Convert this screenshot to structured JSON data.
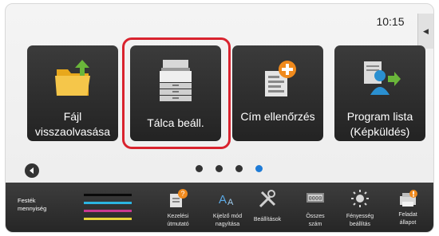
{
  "status": {
    "time": "10:15"
  },
  "tiles": [
    {
      "label": "Fájl visszaolvasása",
      "icon": "folder-upload-icon"
    },
    {
      "label": "Tálca beáll.",
      "icon": "printer-tray-icon"
    },
    {
      "label": "Cím ellenőrzés",
      "icon": "address-book-add-icon"
    },
    {
      "label": "Program lista (Képküldés)",
      "icon": "program-list-send-icon"
    }
  ],
  "pager": {
    "page_count": 4,
    "current_page": 4
  },
  "bottom_bar": {
    "toner": {
      "label": "Festék mennyiség",
      "colors": [
        "#0a0a0a",
        "#2bb4e0",
        "#c8388f",
        "#e6d23a"
      ]
    },
    "buttons": [
      {
        "label": "Kezelési útmutató",
        "icon": "manual-help-icon"
      },
      {
        "label": "Kijelző mód nagyítása",
        "icon": "display-zoom-icon"
      },
      {
        "label": "Beállítások",
        "icon": "settings-tools-icon"
      },
      {
        "label": "Összes szám",
        "icon": "total-count-icon"
      },
      {
        "label": "Fényesség beállítás",
        "icon": "brightness-icon"
      },
      {
        "label": "Feladat állapot",
        "icon": "job-status-icon"
      }
    ]
  },
  "colors": {
    "highlight": "#d9232e",
    "active_dot": "#1e7bd6",
    "tile": "#2f2f2f"
  }
}
